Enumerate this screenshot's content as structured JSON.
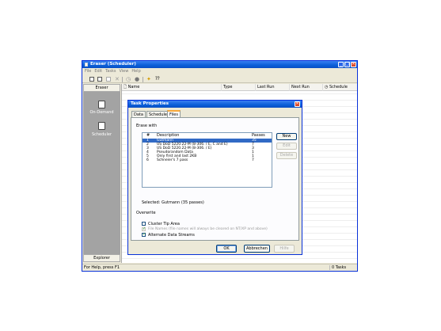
{
  "window": {
    "title": "Eraser (Scheduler)",
    "minimize": "_",
    "maximize": "□",
    "close": "✕"
  },
  "menu": [
    "File",
    "Edit",
    "Tasks",
    "View",
    "Help"
  ],
  "sidebar": {
    "header": "Eraser",
    "items": [
      {
        "label": "On-Demand",
        "icon": "document-icon"
      },
      {
        "label": "Scheduler",
        "icon": "clock-document-icon"
      }
    ],
    "footer": "Explorer"
  },
  "task_list": {
    "columns": [
      "Name",
      "Type",
      "Last Run",
      "Next Run",
      "Schedule"
    ]
  },
  "status": {
    "left": "For Help, press F1",
    "right": "0 Tasks"
  },
  "dialog": {
    "title": "Task Properties",
    "close": "✕",
    "tabs": [
      "Data",
      "Schedule",
      "Files"
    ],
    "active_tab": "Files",
    "erase_with": "Erase with",
    "method_columns": [
      "#",
      "Description",
      "Passes"
    ],
    "methods": [
      {
        "num": "1",
        "description": "Gutmann",
        "passes": "35",
        "selected": true
      },
      {
        "num": "2",
        "description": "US DoD 5220.22-M (8-306. / E, C and E)",
        "passes": "7"
      },
      {
        "num": "3",
        "description": "US DoD 5220.22-M (8-306. / E)",
        "passes": "3"
      },
      {
        "num": "4",
        "description": "Pseudorandom Data",
        "passes": "1"
      },
      {
        "num": "5",
        "description": "Only first and last 2KB",
        "passes": "1"
      },
      {
        "num": "6",
        "description": "Schneier's 7 pass",
        "passes": "7"
      }
    ],
    "side_buttons": {
      "new": "New",
      "edit": "Edit",
      "delete": "Delete"
    },
    "selected_text": "Selected: Gutmann (35 passes)",
    "overwrite_label": "Overwrite",
    "options": {
      "cluster_tip": "Cluster Tip Area",
      "file_names": "File Names (file names will always be cleared on NT/XP and above)",
      "ads": "Alternate Data Streams"
    },
    "buttons": {
      "ok": "OK",
      "cancel": "Abbrechen",
      "help": "Hilfe"
    }
  }
}
